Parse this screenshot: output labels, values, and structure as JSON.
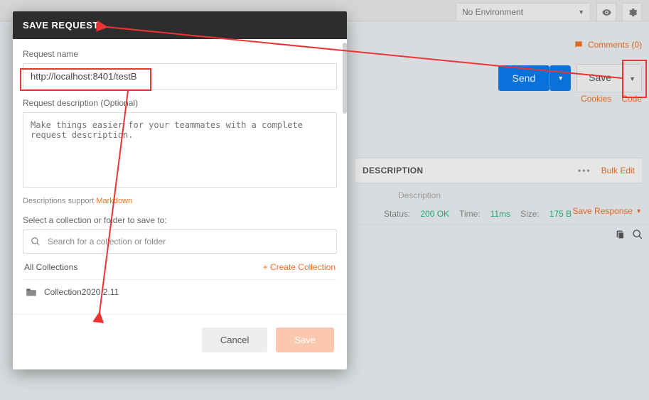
{
  "top": {
    "environment": "No Environment",
    "comments_label": "Comments (0)"
  },
  "request_bar": {
    "send_label": "Send",
    "save_label": "Save",
    "cookies_label": "Cookies",
    "code_label": "Code"
  },
  "params": {
    "desc_header": "DESCRIPTION",
    "bulk_edit": "Bulk Edit",
    "desc_placeholder": "Description"
  },
  "response": {
    "status_label": "Status:",
    "status_value": "200 OK",
    "time_label": "Time:",
    "time_value": "11ms",
    "size_label": "Size:",
    "size_value": "175 B",
    "save_response": "Save Response"
  },
  "modal": {
    "title": "SAVE REQUEST",
    "name_label": "Request name",
    "name_value": "http://localhost:8401/testB",
    "desc_label": "Request description (Optional)",
    "desc_placeholder": "Make things easier for your teammates with a complete request description.",
    "md_prefix": "Descriptions support ",
    "md_link": "Markdown",
    "select_label": "Select a collection or folder to save to:",
    "search_placeholder": "Search for a collection or folder",
    "all_collections": "All Collections",
    "create_collection": "+ Create Collection",
    "collection_name": "Collection2020.2.11",
    "cancel": "Cancel",
    "save": "Save"
  }
}
